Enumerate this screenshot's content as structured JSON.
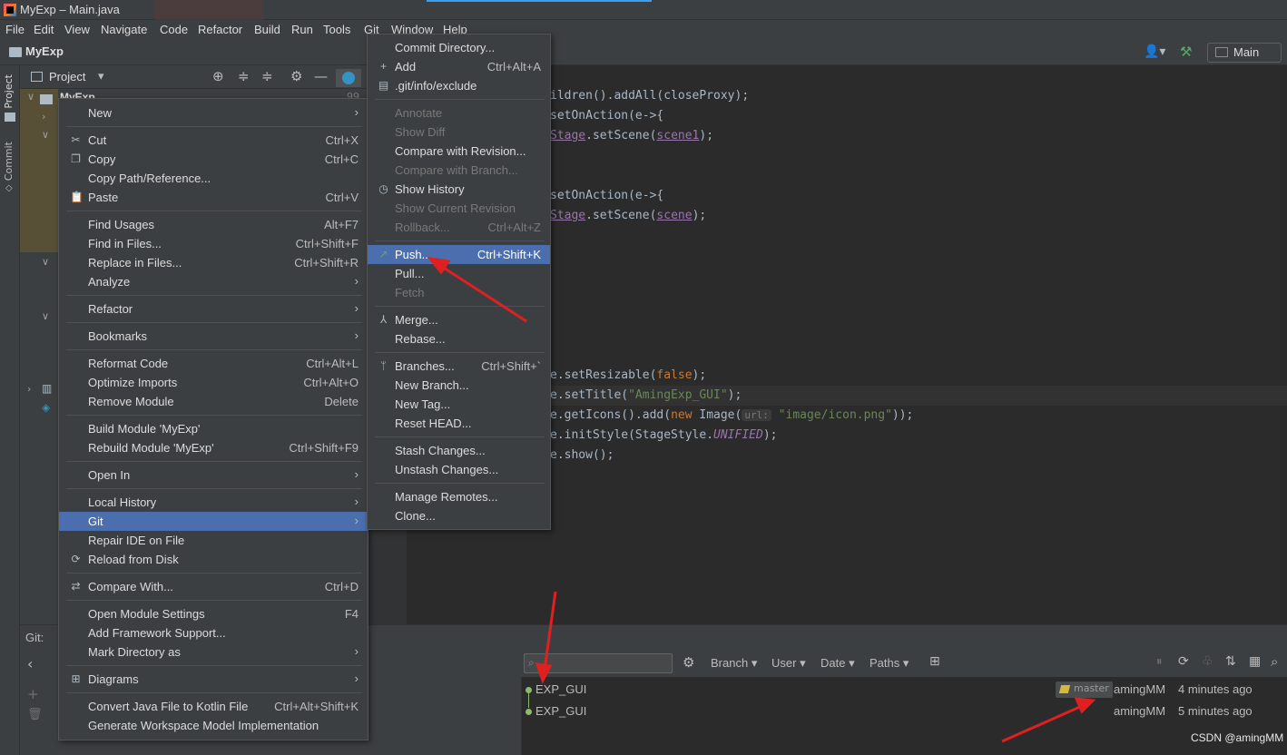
{
  "window": {
    "title": "MyExp – Main.java"
  },
  "menubar": [
    "File",
    "Edit",
    "View",
    "Navigate",
    "Code",
    "Refactor",
    "Build",
    "Run",
    "Tools",
    "Git",
    "Window",
    "Help"
  ],
  "navbar": {
    "project": "MyExp",
    "run_config": "Main"
  },
  "side_tabs": {
    "project": "Project",
    "commit": "Commit"
  },
  "project_panel": {
    "title": "Project",
    "root_label": "MyExp",
    "root_count": "99"
  },
  "editor": {
    "lines": [
      {
        "a": "ildren().addAll(closeProxy);"
      },
      {
        "a": "setOnAction(e->{"
      },
      {
        "pre": "",
        "fld": "Stage",
        "mid": ".setScene(",
        "fld2": "scene1",
        "post": ");"
      },
      {
        "a": "setOnAction(e->{"
      },
      {
        "pre": "",
        "fld": "Stage",
        "mid": ".setScene(",
        "fld2": "scene",
        "post": ");"
      },
      {
        "pre": "e.setResizable(",
        "kw": "false",
        "post": ");"
      },
      {
        "pre": "e.setTitle(",
        "str": "\"AmingExp_GUI\"",
        "post": ");"
      },
      {
        "pre": "e.getIcons().add(",
        "kw": "new",
        "mid": " Image(",
        "hint": "url:",
        "str": "\"image/icon.png\"",
        "post": "));"
      },
      {
        "pre": "e.initStyle(StageStyle.",
        "it": "UNIFIED",
        "post": ");"
      },
      {
        "a": "e.show();"
      }
    ]
  },
  "context_menu": {
    "items": [
      {
        "label": "New",
        "sub": true
      },
      {
        "label": "Cut",
        "shortcut": "Ctrl+X",
        "icon": "scissors-icon"
      },
      {
        "label": "Copy",
        "shortcut": "Ctrl+C",
        "icon": "copy-icon"
      },
      {
        "label": "Copy Path/Reference..."
      },
      {
        "label": "Paste",
        "shortcut": "Ctrl+V",
        "icon": "paste-icon"
      },
      {
        "label": "Find Usages",
        "shortcut": "Alt+F7"
      },
      {
        "label": "Find in Files...",
        "shortcut": "Ctrl+Shift+F"
      },
      {
        "label": "Replace in Files...",
        "shortcut": "Ctrl+Shift+R"
      },
      {
        "label": "Analyze",
        "sub": true
      },
      {
        "label": "Refactor",
        "sub": true
      },
      {
        "label": "Bookmarks",
        "sub": true
      },
      {
        "label": "Reformat Code",
        "shortcut": "Ctrl+Alt+L"
      },
      {
        "label": "Optimize Imports",
        "shortcut": "Ctrl+Alt+O"
      },
      {
        "label": "Remove Module",
        "shortcut": "Delete"
      },
      {
        "label": "Build Module 'MyExp'"
      },
      {
        "label": "Rebuild Module 'MyExp'",
        "shortcut": "Ctrl+Shift+F9"
      },
      {
        "label": "Open In",
        "sub": true
      },
      {
        "label": "Local History",
        "sub": true
      },
      {
        "label": "Git",
        "sub": true
      },
      {
        "label": "Repair IDE on File"
      },
      {
        "label": "Reload from Disk",
        "icon": "reload-icon"
      },
      {
        "label": "Compare With...",
        "shortcut": "Ctrl+D",
        "icon": "compare-icon"
      },
      {
        "label": "Open Module Settings",
        "shortcut": "F4"
      },
      {
        "label": "Add Framework Support..."
      },
      {
        "label": "Mark Directory as",
        "sub": true
      },
      {
        "label": "Diagrams",
        "sub": true,
        "icon": "diagram-icon"
      },
      {
        "label": "Convert Java File to Kotlin File",
        "shortcut": "Ctrl+Alt+Shift+K"
      },
      {
        "label": "Generate Workspace Model Implementation"
      }
    ]
  },
  "git_menu": {
    "items": [
      {
        "label": "Commit Directory..."
      },
      {
        "label": "Add",
        "shortcut": "Ctrl+Alt+A",
        "icon": "plus-icon"
      },
      {
        "label": ".git/info/exclude",
        "icon": "file-icon"
      },
      {
        "label": "Annotate"
      },
      {
        "label": "Show Diff"
      },
      {
        "label": "Compare with Revision..."
      },
      {
        "label": "Compare with Branch..."
      },
      {
        "label": "Show History",
        "icon": "clock-icon"
      },
      {
        "label": "Show Current Revision"
      },
      {
        "label": "Rollback...",
        "shortcut": "Ctrl+Alt+Z"
      },
      {
        "label": "Push...",
        "shortcut": "Ctrl+Shift+K",
        "icon": "push-arrow-icon"
      },
      {
        "label": "Pull..."
      },
      {
        "label": "Fetch"
      },
      {
        "label": "Merge...",
        "icon": "merge-icon"
      },
      {
        "label": "Rebase..."
      },
      {
        "label": "Branches...",
        "shortcut": "Ctrl+Shift+`",
        "icon": "branch-icon"
      },
      {
        "label": "New Branch..."
      },
      {
        "label": "New Tag..."
      },
      {
        "label": "Reset HEAD..."
      },
      {
        "label": "Stash Changes..."
      },
      {
        "label": "Unstash Changes..."
      },
      {
        "label": "Manage Remotes..."
      },
      {
        "label": "Clone..."
      }
    ]
  },
  "git_panel": {
    "tab": "Git:",
    "filters": [
      "Branch",
      "User",
      "Date",
      "Paths"
    ],
    "commits": [
      {
        "message": "EXP_GUI",
        "tag": "master",
        "author": "amingMM",
        "time": "4 minutes ago"
      },
      {
        "message": "EXP_GUI",
        "author": "amingMM",
        "time": "5 minutes ago"
      }
    ]
  },
  "watermark": "CSDN @amingMM",
  "colors": {
    "selection": "#4b6eaf",
    "annotation_arrow": "#e02020",
    "panel": "#3c3f41",
    "editor": "#2b2b2b"
  }
}
